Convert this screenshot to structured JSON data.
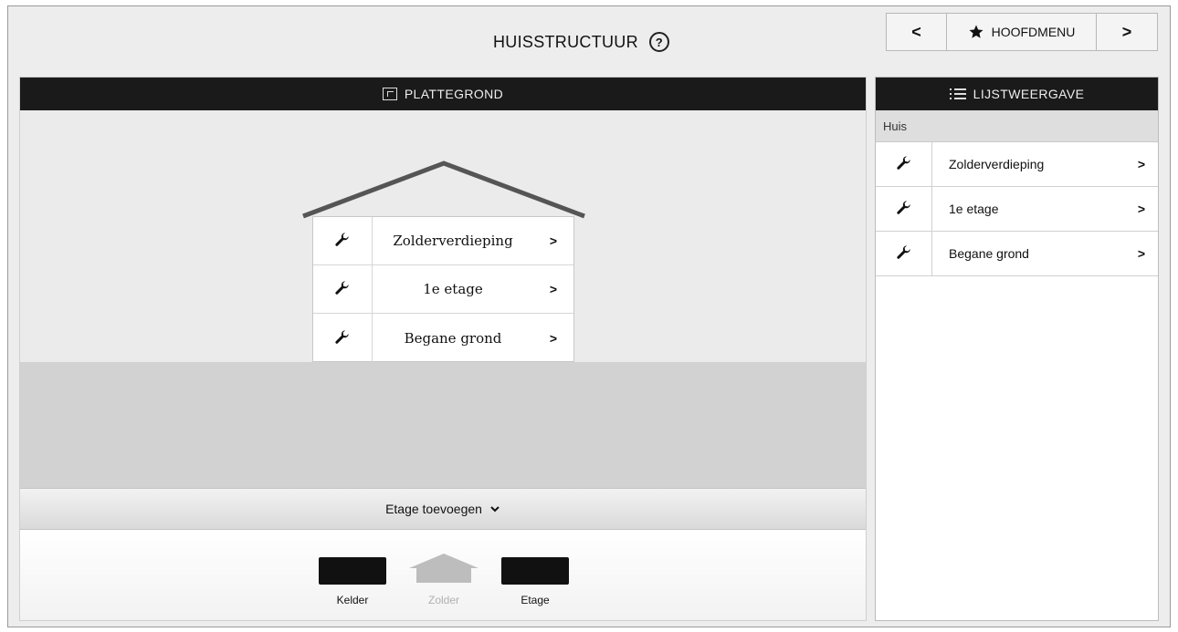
{
  "header": {
    "title": "HUISSTRUCTUUR",
    "help_glyph": "?"
  },
  "nav": {
    "prev_glyph": "<",
    "home_label": "HOOFDMENU",
    "next_glyph": ">"
  },
  "floorplan": {
    "title": "PLATTEGROND",
    "floors": [
      {
        "label": "Zolderverdieping",
        "icon": "wrench-icon"
      },
      {
        "label": "1e etage",
        "icon": "wrench-icon"
      },
      {
        "label": "Begane grond",
        "icon": "wrench-icon"
      }
    ],
    "add_floor_label": "Etage toevoegen",
    "add_options": [
      {
        "label": "Kelder",
        "enabled": true
      },
      {
        "label": "Zolder",
        "enabled": false
      },
      {
        "label": "Etage",
        "enabled": true
      }
    ]
  },
  "listview": {
    "title": "LIJSTWEERGAVE",
    "breadcrumb": "Huis",
    "items": [
      {
        "label": "Zolderverdieping",
        "icon": "wrench-icon"
      },
      {
        "label": "1e etage",
        "icon": "wrench-icon"
      },
      {
        "label": "Begane grond",
        "icon": "wrench-icon"
      }
    ]
  },
  "colors": {
    "panel_header": "#1a1a1a",
    "roof": "#555555",
    "background": "#ededed"
  }
}
